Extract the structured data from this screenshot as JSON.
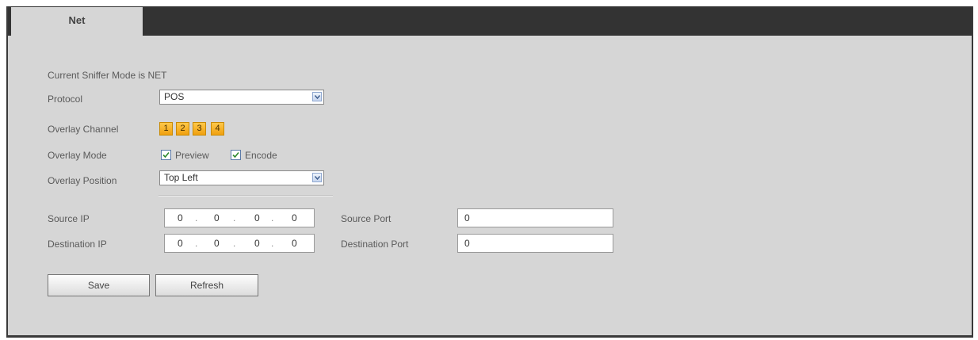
{
  "tab": {
    "label": "Net"
  },
  "status": {
    "text": "Current Sniffer Mode is NET"
  },
  "protocol": {
    "label": "Protocol",
    "value": "POS"
  },
  "overlay_channel": {
    "label": "Overlay Channel",
    "channels": [
      "1",
      "2",
      "3",
      "4"
    ]
  },
  "overlay_mode": {
    "label": "Overlay Mode",
    "preview": {
      "label": "Preview",
      "checked": true
    },
    "encode": {
      "label": "Encode",
      "checked": true
    }
  },
  "overlay_position": {
    "label": "Overlay Position",
    "value": "Top Left"
  },
  "source_ip": {
    "label": "Source IP",
    "octets": [
      "0",
      "0",
      "0",
      "0"
    ]
  },
  "destination_ip": {
    "label": "Destination IP",
    "octets": [
      "0",
      "0",
      "0",
      "0"
    ]
  },
  "source_port": {
    "label": "Source Port",
    "value": "0"
  },
  "destination_port": {
    "label": "Destination Port",
    "value": "0"
  },
  "buttons": {
    "save": "Save",
    "refresh": "Refresh"
  },
  "colors": {
    "tab_bar": "#333333",
    "panel": "#d6d6d6",
    "channel_button": "#f5b02a",
    "checkbox_border": "#5b7aa8"
  },
  "icons": {
    "dropdown": "chevron-down-icon",
    "check": "check-icon"
  }
}
